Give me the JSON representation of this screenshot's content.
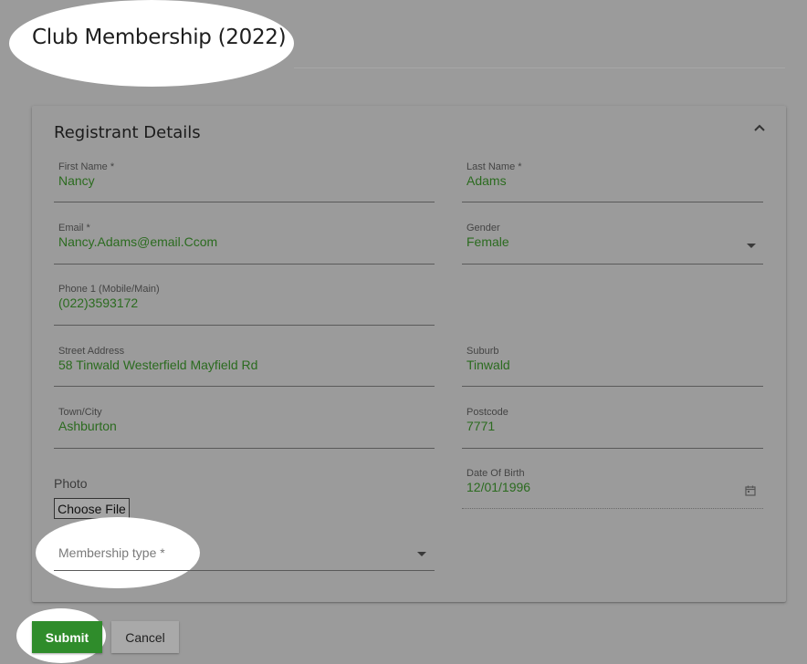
{
  "page": {
    "title": "Club Membership (2022)"
  },
  "section": {
    "title": "Registrant Details"
  },
  "fields": {
    "first_name": {
      "label": "First Name *",
      "value": "Nancy"
    },
    "last_name": {
      "label": "Last Name *",
      "value": "Adams"
    },
    "email": {
      "label": "Email *",
      "value": "Nancy.Adams@email.Ccom"
    },
    "gender": {
      "label": "Gender",
      "value": "Female"
    },
    "phone": {
      "label": "Phone 1 (Mobile/Main)",
      "value": "(022)3593172"
    },
    "street": {
      "label": "Street Address",
      "value": "58 Tinwald Westerfield Mayfield Rd"
    },
    "suburb": {
      "label": "Suburb",
      "value": "Tinwald"
    },
    "town": {
      "label": "Town/City",
      "value": "Ashburton"
    },
    "postcode": {
      "label": "Postcode",
      "value": "7771"
    },
    "dob": {
      "label": "Date Of Birth",
      "value": "12/01/1996"
    },
    "photo": {
      "label": "Photo",
      "button": "Choose File"
    },
    "membership_type": {
      "placeholder": "Membership type *"
    }
  },
  "actions": {
    "submit": "Submit",
    "cancel": "Cancel"
  },
  "icons": {
    "collapse": "chevron-up-icon",
    "dropdown": "caret-down-icon",
    "calendar": "calendar-icon"
  },
  "colors": {
    "accent": "#2f8c2b",
    "value_text": "#2b6b1f",
    "background": "#9b9b9b"
  }
}
